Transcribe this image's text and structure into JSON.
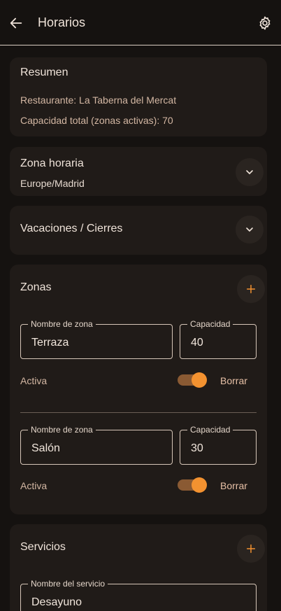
{
  "appbar": {
    "title": "Horarios",
    "back_icon": "arrow-left-icon",
    "settings_icon": "gear-icon"
  },
  "colors": {
    "background": "#151210",
    "card": "#201b18",
    "accent": "#f39230"
  },
  "summary": {
    "title": "Resumen",
    "restaurant": "Restaurante: La Taberna del Mercat",
    "capacity": "Capacidad total (zonas activas): 70"
  },
  "timezone": {
    "title": "Zona horaria",
    "value": "Europe/Madrid"
  },
  "vacations": {
    "title": "Vacaciones / Cierres"
  },
  "zones": {
    "title": "Zonas",
    "items": [
      {
        "name_label": "Nombre de zona",
        "name": "Terraza",
        "capacity_label": "Capacidad",
        "capacity": "40",
        "active_label": "Activa",
        "active": true,
        "delete_label": "Borrar"
      },
      {
        "name_label": "Nombre de zona",
        "name": "Salón",
        "capacity_label": "Capacidad",
        "capacity": "30",
        "active_label": "Activa",
        "active": true,
        "delete_label": "Borrar"
      }
    ]
  },
  "services": {
    "title": "Servicios",
    "items": [
      {
        "name_label": "Nombre del servicio",
        "name": "Desayuno"
      }
    ]
  }
}
